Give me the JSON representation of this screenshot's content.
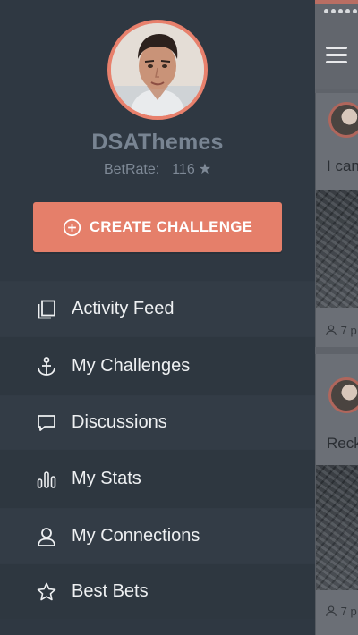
{
  "profile": {
    "name": "DSAThemes",
    "rate_label": "BetRate:",
    "rate_value": "116",
    "rate_star": "★"
  },
  "actions": {
    "create_label": "CREATE CHALLENGE"
  },
  "menu": {
    "items": [
      {
        "label": "Activity Feed",
        "icon": "copy-icon"
      },
      {
        "label": "My Challenges",
        "icon": "anchor-icon"
      },
      {
        "label": "Discussions",
        "icon": "chat-bubble-icon"
      },
      {
        "label": "My Stats",
        "icon": "bar-chart-icon"
      },
      {
        "label": "My Connections",
        "icon": "user-icon"
      },
      {
        "label": "Best Bets",
        "icon": "star-icon"
      }
    ]
  },
  "feed": {
    "cards": [
      {
        "text": "I can",
        "footer": "7 p"
      },
      {
        "text": "Reck",
        "footer": "7 p"
      }
    ]
  },
  "colors": {
    "accent": "#e57f6a",
    "sidebar_bg": "#2f3842",
    "name_text": "#788492"
  }
}
